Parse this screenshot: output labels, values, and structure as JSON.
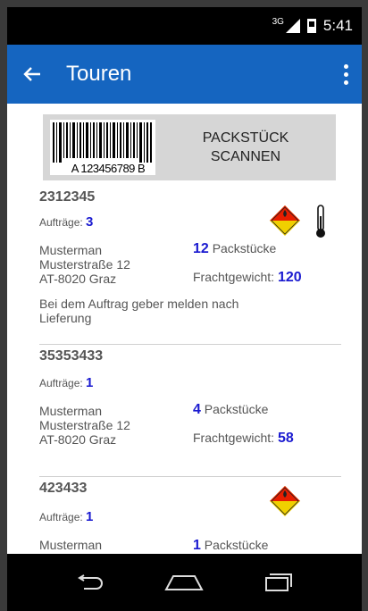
{
  "status_bar": {
    "network": "3G",
    "time": "5:41"
  },
  "app_bar": {
    "title": "Touren"
  },
  "scan": {
    "barcode_text": "A 123456789 B",
    "label_line1": "PACKSTÜCK",
    "label_line2": "SCANNEN"
  },
  "tours": [
    {
      "id": "2312345",
      "orders_label": "Aufträge:",
      "orders": "3",
      "name": "Musterman",
      "street": "Musterstraße 12",
      "city": "AT-8020 Graz",
      "packages": "12",
      "packages_label": "Packstücke",
      "weight_label": "Frachtgewicht:",
      "weight": "120",
      "note_line1": "Bei dem Auftrag geber melden nach",
      "note_line2": "Lieferung",
      "icons": [
        "hazard-icon",
        "thermometer-icon"
      ]
    },
    {
      "id": "35353433",
      "orders_label": "Aufträge:",
      "orders": "1",
      "name": "Musterman",
      "street": "Musterstraße 12",
      "city": "AT-8020 Graz",
      "packages": "4",
      "packages_label": "Packstücke",
      "weight_label": "Frachtgewicht:",
      "weight": "58"
    },
    {
      "id": "423433",
      "orders_label": "Aufträge:",
      "orders": "1",
      "name": "Musterman",
      "packages": "1",
      "packages_label": "Packstücke",
      "icons": [
        "hazard-icon"
      ]
    }
  ],
  "colors": {
    "app_bar": "#1565c0",
    "accent_number": "#1a1ad0",
    "scan_button": "#d6d6d6"
  }
}
